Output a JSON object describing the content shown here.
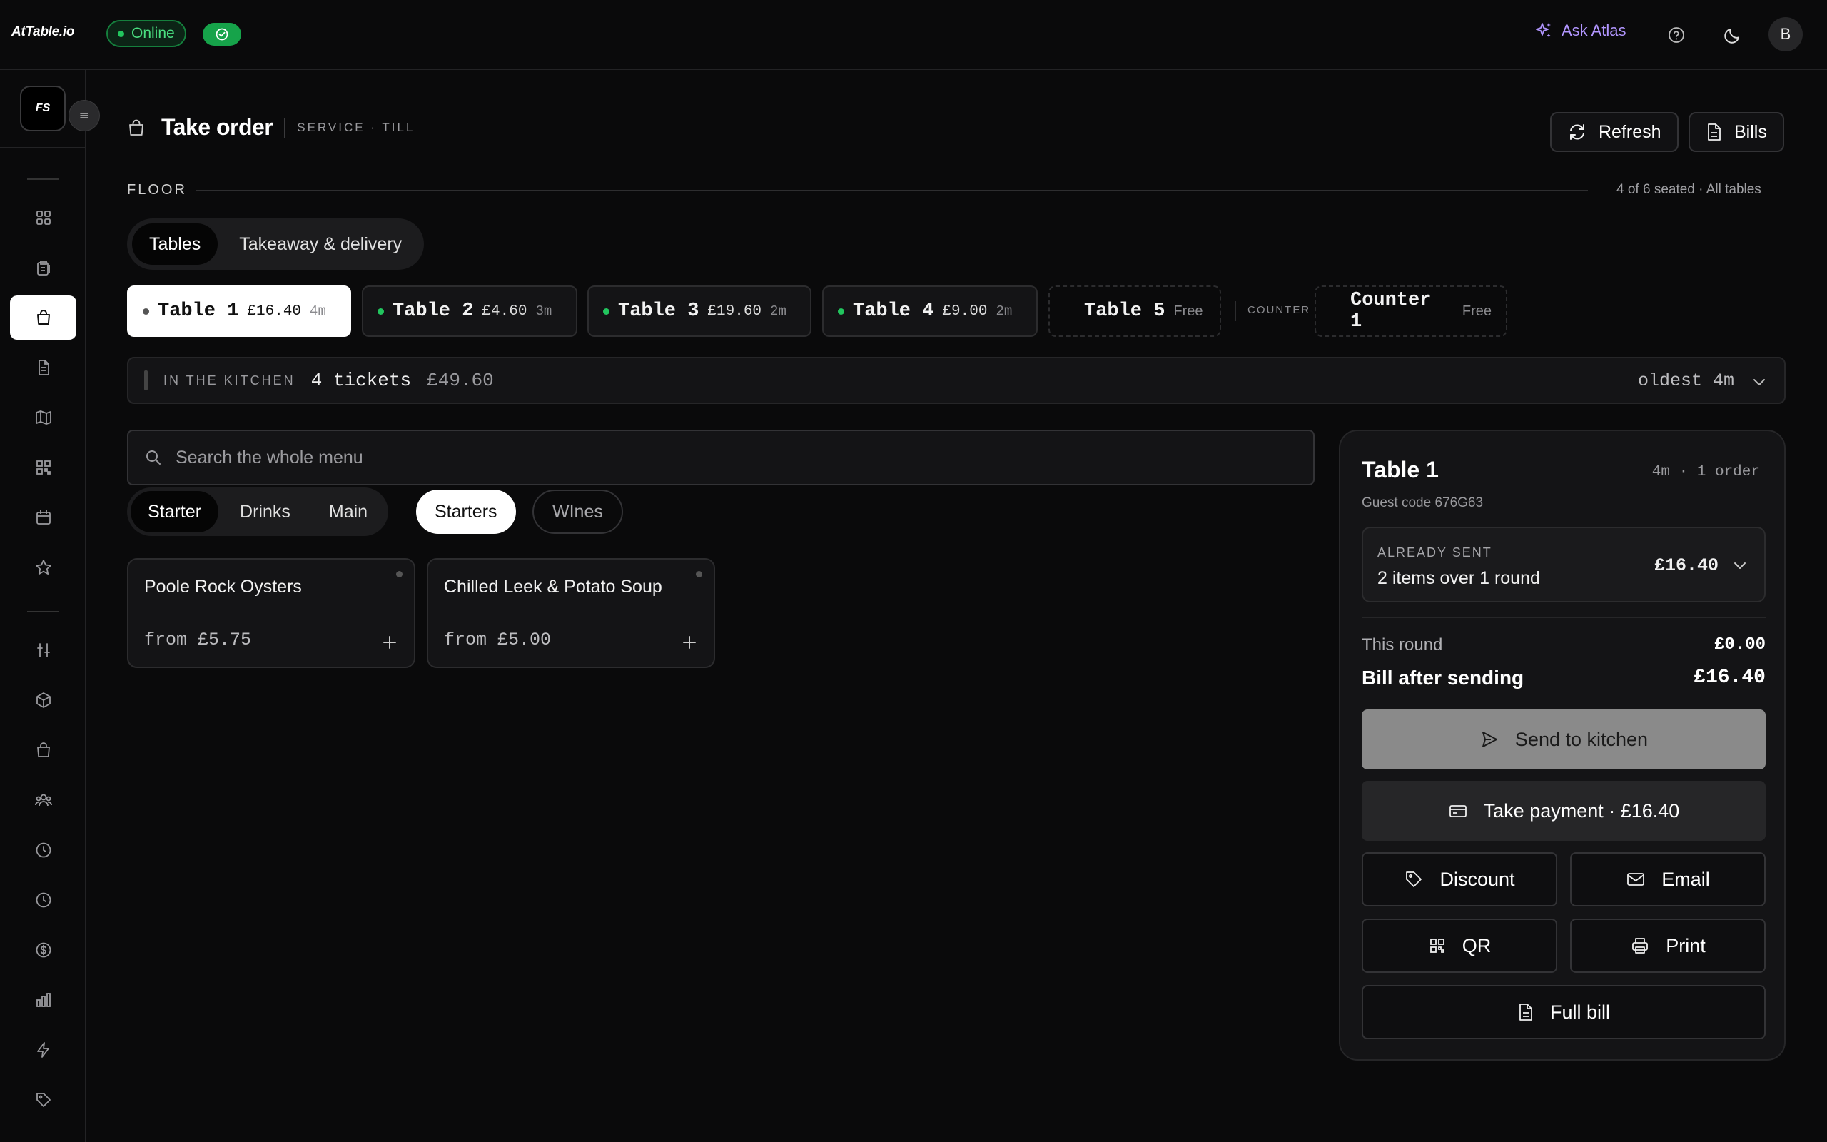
{
  "app": {
    "logo": "AtTable.io",
    "brand_mark": "FS"
  },
  "status": {
    "online_label": "Online"
  },
  "topbar": {
    "ask_atlas": "Ask Atlas",
    "avatar_initial": "B"
  },
  "colors": {
    "accent_purple": "#b296ff",
    "online_green": "#22c55e",
    "background": "#0a0a0b"
  },
  "page": {
    "title": "Take order",
    "subtitle": "SERVICE · TILL",
    "refresh_label": "Refresh",
    "bills_label": "Bills"
  },
  "floor": {
    "label": "FLOOR",
    "meta": "4 of 6 seated · All tables",
    "tabs": [
      "Tables",
      "Takeaway & delivery"
    ],
    "active_tab": "Tables",
    "counter_label": "COUNTER",
    "tables": [
      {
        "name": "Table 1",
        "amount": "£16.40",
        "age": "4m",
        "status": "selected"
      },
      {
        "name": "Table 2",
        "amount": "£4.60",
        "age": "3m",
        "status": "occupied"
      },
      {
        "name": "Table 3",
        "amount": "£19.60",
        "age": "2m",
        "status": "occupied"
      },
      {
        "name": "Table 4",
        "amount": "£9.00",
        "age": "2m",
        "status": "occupied"
      },
      {
        "name": "Table 5",
        "free_label": "Free",
        "status": "free"
      },
      {
        "name": "Counter 1",
        "free_label": "Free",
        "status": "free"
      }
    ]
  },
  "kitchen": {
    "label": "IN THE KITCHEN",
    "tickets": "4 tickets",
    "total": "£49.60",
    "oldest": "oldest 4m"
  },
  "menu": {
    "search_placeholder": "Search the whole menu",
    "course_tabs": [
      "Starter",
      "Drinks",
      "Main"
    ],
    "active_course": "Starter",
    "categories": [
      "Starters",
      "WInes"
    ],
    "active_category": "Starters",
    "items": [
      {
        "name": "Poole Rock Oysters",
        "price": "from £5.75"
      },
      {
        "name": "Chilled Leek & Potato Soup",
        "price": "from £5.00"
      }
    ]
  },
  "order": {
    "title": "Table 1",
    "meta": "4m · 1 order",
    "guest_code": "Guest code 676G63",
    "already_sent_label": "ALREADY SENT",
    "already_sent_desc": "2 items over 1 round",
    "already_sent_amount": "£16.40",
    "this_round_label": "This round",
    "this_round_value": "£0.00",
    "bill_after_label": "Bill after sending",
    "bill_after_value": "£16.40",
    "send_label": "Send to kitchen",
    "pay_label": "Take payment · £16.40",
    "discount_label": "Discount",
    "email_label": "Email",
    "qr_label": "QR",
    "print_label": "Print",
    "full_bill_label": "Full bill"
  }
}
